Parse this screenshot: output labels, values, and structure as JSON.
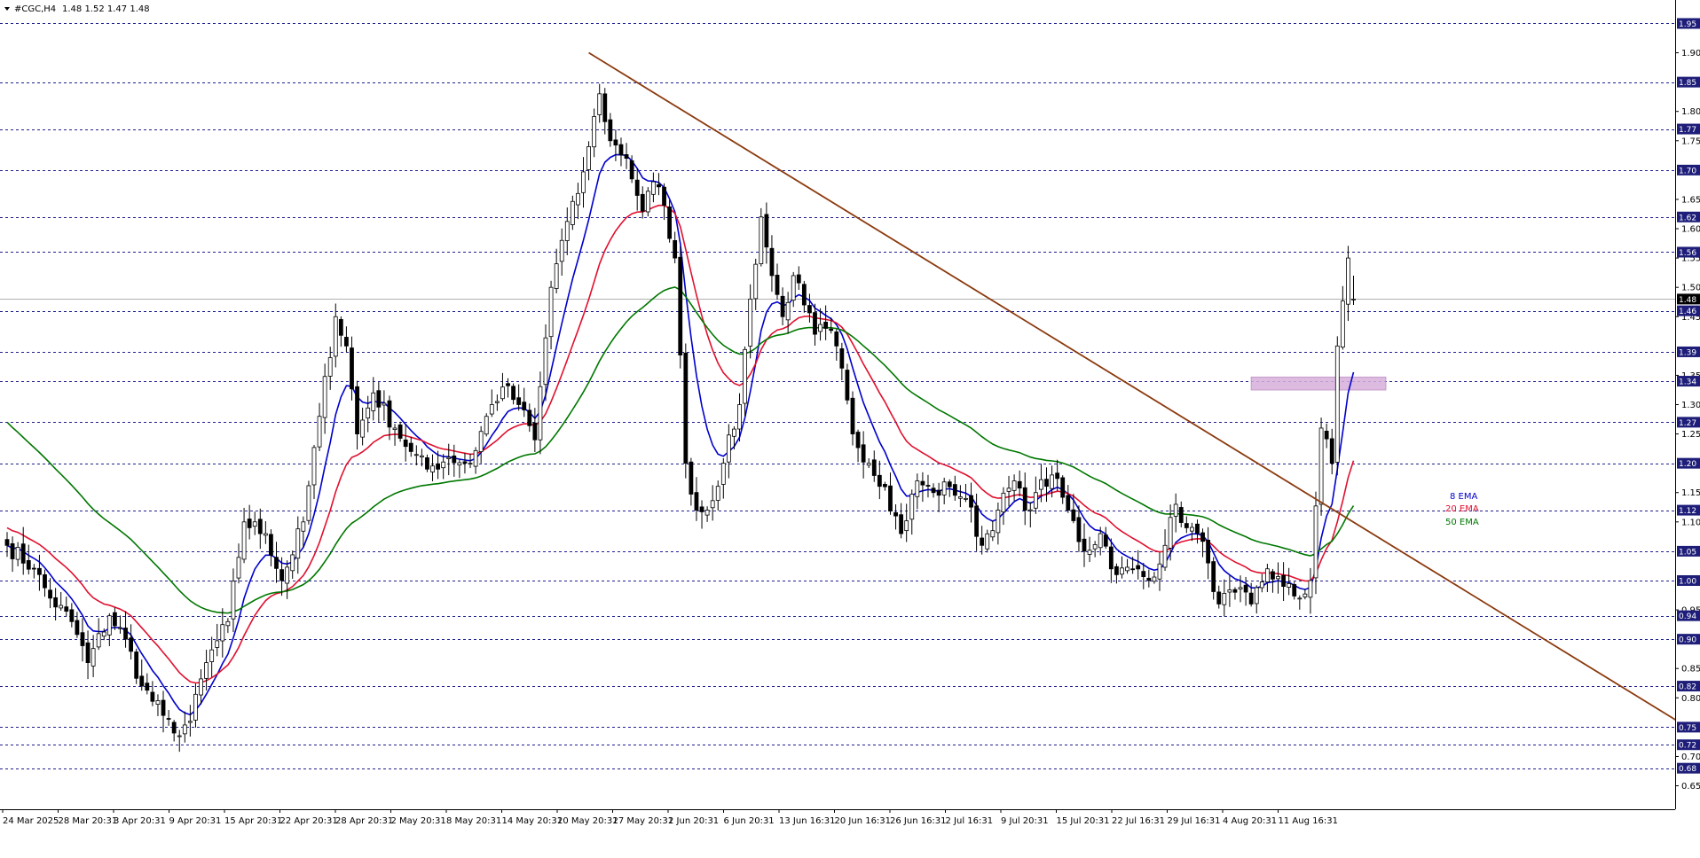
{
  "header": {
    "symbol_label": "#CGC,H4",
    "ohlc_label": "1.48 1.52 1.47 1.48"
  },
  "colors": {
    "ema8": "#0000cc",
    "ema20": "#e0102f",
    "ema50": "#007700",
    "trendline": "#8b3a0e",
    "zone": "#d8b0dc",
    "grid": "#1f1f8f",
    "candle_bull_fill": "#ffffff",
    "candle_bear_fill": "#000000"
  },
  "chart_data": {
    "type": "candlestick",
    "x_labels": [
      "24 Mar 2025",
      "28 Mar 20:31",
      "3 Apr 20:31",
      "9 Apr 20:31",
      "15 Apr 20:31",
      "22 Apr 20:31",
      "28 Apr 20:31",
      "2 May 20:31",
      "8 May 20:31",
      "14 May 20:31",
      "20 May 20:31",
      "27 May 20:31",
      "2 Jun 20:31",
      "6 Jun 20:31",
      "13 Jun 16:31",
      "20 Jun 16:31",
      "26 Jun 16:31",
      "2 Jul 16:31",
      "9 Jul 20:31",
      "15 Jul 20:31",
      "22 Jul 16:31",
      "29 Jul 16:31",
      "4 Aug 20:31",
      "11 Aug 16:31"
    ],
    "y_ticks": [
      1.9,
      1.8,
      1.75,
      1.65,
      1.6,
      1.55,
      1.5,
      1.45,
      1.35,
      1.3,
      1.25,
      1.15,
      1.1,
      0.95,
      0.85,
      0.8,
      0.7,
      0.65
    ],
    "level_tags": [
      1.95,
      1.85,
      1.77,
      1.7,
      1.62,
      1.56,
      1.46,
      1.39,
      1.34,
      1.27,
      1.2,
      1.12,
      1.05,
      1.0,
      0.94,
      0.9,
      0.82,
      0.75,
      0.72,
      0.68
    ],
    "current_price": 1.48,
    "ylim": [
      0.61,
      1.99
    ],
    "indicator_labels": [
      "8 EMA",
      "20 EMA",
      "50 EMA"
    ],
    "trendline": {
      "start": {
        "index": 108,
        "price": 1.9
      },
      "end": {
        "index": 312,
        "price": 0.75
      }
    },
    "resistance_zone": {
      "from_index": 231,
      "to_index": 256,
      "low": 1.325,
      "high": 1.347
    },
    "candle_count": 250,
    "close_anchors": [
      [
        0,
        1.06
      ],
      [
        5,
        1.02
      ],
      [
        8,
        0.97
      ],
      [
        12,
        0.93
      ],
      [
        15,
        0.86
      ],
      [
        19,
        0.94
      ],
      [
        22,
        0.9
      ],
      [
        25,
        0.82
      ],
      [
        29,
        0.77
      ],
      [
        31,
        0.74
      ],
      [
        34,
        0.76
      ],
      [
        37,
        0.86
      ],
      [
        41,
        0.93
      ],
      [
        44,
        1.1
      ],
      [
        48,
        1.08
      ],
      [
        51,
        1.0
      ],
      [
        55,
        1.1
      ],
      [
        58,
        1.28
      ],
      [
        61,
        1.45
      ],
      [
        63,
        1.4
      ],
      [
        65,
        1.25
      ],
      [
        68,
        1.32
      ],
      [
        72,
        1.26
      ],
      [
        75,
        1.22
      ],
      [
        78,
        1.19
      ],
      [
        82,
        1.21
      ],
      [
        86,
        1.2
      ],
      [
        89,
        1.28
      ],
      [
        92,
        1.33
      ],
      [
        95,
        1.3
      ],
      [
        98,
        1.24
      ],
      [
        101,
        1.5
      ],
      [
        103,
        1.58
      ],
      [
        106,
        1.66
      ],
      [
        108,
        1.74
      ],
      [
        110,
        1.83
      ],
      [
        112,
        1.75
      ],
      [
        115,
        1.72
      ],
      [
        118,
        1.63
      ],
      [
        120,
        1.68
      ],
      [
        122,
        1.64
      ],
      [
        124,
        1.55
      ],
      [
        126,
        1.2
      ],
      [
        128,
        1.12
      ],
      [
        130,
        1.12
      ],
      [
        133,
        1.2
      ],
      [
        136,
        1.3
      ],
      [
        138,
        1.48
      ],
      [
        140,
        1.62
      ],
      [
        142,
        1.52
      ],
      [
        144,
        1.45
      ],
      [
        146,
        1.52
      ],
      [
        148,
        1.47
      ],
      [
        150,
        1.42
      ],
      [
        152,
        1.43
      ],
      [
        154,
        1.4
      ],
      [
        157,
        1.25
      ],
      [
        160,
        1.2
      ],
      [
        163,
        1.16
      ],
      [
        166,
        1.08
      ],
      [
        169,
        1.17
      ],
      [
        172,
        1.15
      ],
      [
        175,
        1.16
      ],
      [
        178,
        1.14
      ],
      [
        181,
        1.06
      ],
      [
        184,
        1.12
      ],
      [
        187,
        1.17
      ],
      [
        189,
        1.12
      ],
      [
        191,
        1.15
      ],
      [
        194,
        1.18
      ],
      [
        197,
        1.12
      ],
      [
        200,
        1.05
      ],
      [
        203,
        1.08
      ],
      [
        206,
        1.01
      ],
      [
        209,
        1.02
      ],
      [
        212,
        1.0
      ],
      [
        215,
        1.06
      ],
      [
        217,
        1.13
      ],
      [
        219,
        1.09
      ],
      [
        221,
        1.08
      ],
      [
        223,
        1.03
      ],
      [
        225,
        0.96
      ],
      [
        228,
        0.98
      ],
      [
        231,
        0.96
      ],
      [
        234,
        1.02
      ],
      [
        237,
        0.99
      ],
      [
        240,
        0.97
      ],
      [
        242,
        1.0
      ],
      [
        244,
        1.26
      ],
      [
        246,
        1.2
      ],
      [
        247,
        1.4
      ],
      [
        249,
        1.55
      ],
      [
        250,
        1.48
      ]
    ],
    "series": [
      {
        "name": "8 EMA",
        "period": 8
      },
      {
        "name": "20 EMA",
        "period": 20
      },
      {
        "name": "50 EMA",
        "period": 50
      }
    ]
  }
}
